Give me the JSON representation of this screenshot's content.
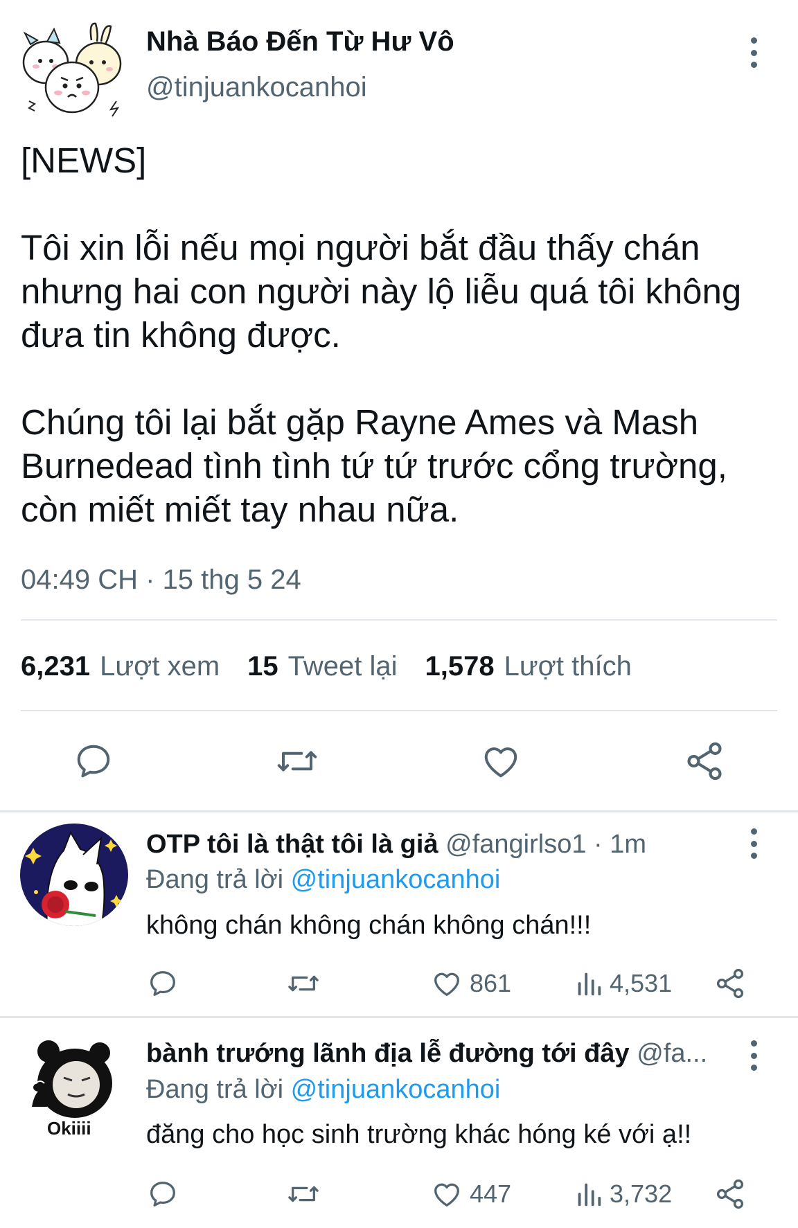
{
  "main_tweet": {
    "author_name": "Nhà Báo Đến Từ Hư Vô",
    "handle": "@tinjuankocanhoi",
    "text": "[NEWS]\n\nTôi xin lỗi nếu mọi người bắt đầu thấy chán nhưng hai con người này lộ liễu quá tôi không đưa tin không được.\n\nChúng tôi lại bắt gặp Rayne Ames và Mash Burnedead tình tình tứ tứ trước cổng trường, còn miết miết tay nhau nữa.",
    "time": "04:49 CH",
    "separator": "·",
    "date": "15 thg 5 24",
    "stats": {
      "views_count": "6,231",
      "views_label": "Lượt xem",
      "retweets_count": "15",
      "retweets_label": "Tweet lại",
      "likes_count": "1,578",
      "likes_label": "Lượt thích"
    },
    "actions": [
      "reply-icon",
      "retweet-icon",
      "heart-icon",
      "share-icon"
    ]
  },
  "replies": [
    {
      "author_name": "OTP tôi là thật tôi là giả",
      "meta": "@fangirlso1 · 1m",
      "replying_label": "Đang trả lời",
      "replying_to": "@tinjuankocanhoi",
      "text": "không chán không chán không chán!!!",
      "likes": "861",
      "views": "4,531"
    },
    {
      "author_name": "bành trướng lãnh địa lễ đường tới đây",
      "meta": "@fa...",
      "replying_label": "Đang trả lời",
      "replying_to": "@tinjuankocanhoi",
      "text": "đăng cho học sinh trường khác hóng ké với ạ!!",
      "likes": "447",
      "views": "3,732",
      "avatar_caption": "Okiiii"
    }
  ],
  "colors": {
    "text": "#0f1419",
    "secondary": "#536471",
    "link": "#1d9bf0",
    "divider": "#e1e6ea"
  }
}
